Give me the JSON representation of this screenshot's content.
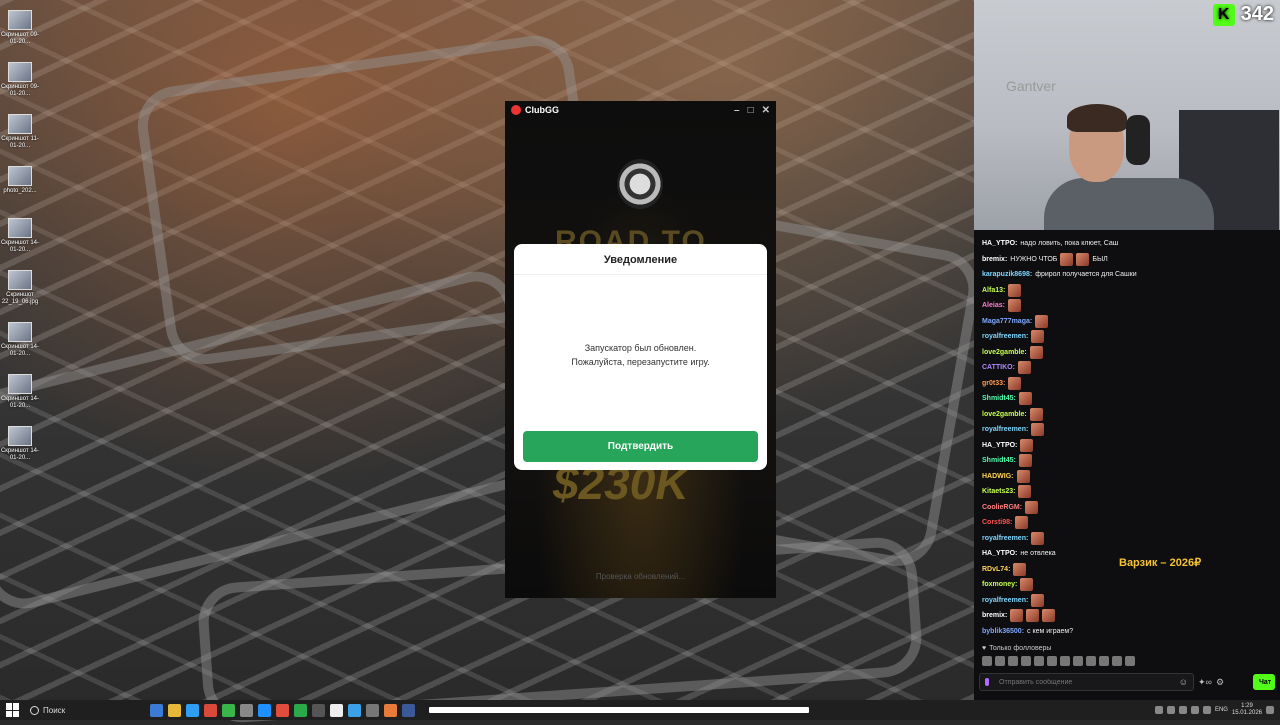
{
  "desktop": {
    "icons": [
      {
        "label": "Скриншот 09-01-20..."
      },
      {
        "label": "Скриншот 09-01-20..."
      },
      {
        "label": "Скриншот 11-01-20..."
      },
      {
        "label": "photo_202..."
      },
      {
        "label": "Скриншот 14-01-20..."
      },
      {
        "label": "Скриншот 22_19_06.jpg"
      },
      {
        "label": "Скриншот 14-01-20..."
      },
      {
        "label": "Скриншот 14-01-20..."
      },
      {
        "label": "Скриншот 14-01-20..."
      }
    ]
  },
  "launcher": {
    "title": "ClubGG",
    "road_to": "ROAD TO",
    "prize": "$230K",
    "status": "Проверка обновлений..."
  },
  "dialog": {
    "title": "Уведомление",
    "message_line1": "Запускатор был обновлен.",
    "message_line2": "Пожалуйста, перезапустите игру.",
    "confirm_label": "Подтвердить"
  },
  "stream": {
    "viewer_count": "342",
    "wall_text": "Gantver",
    "overlay_text": "Варзик – 2026₽"
  },
  "chat": {
    "messages": [
      {
        "user": "HA_YTPO:",
        "text": "надо ловить, пока клюет, Саш",
        "color": "#ffffff",
        "emotes": 0
      },
      {
        "user": "bremix:",
        "text": "НУЖНО ЧТОБ",
        "text2": "БЫЛ",
        "color": "#ffffff",
        "emotes": 2
      },
      {
        "user": "karapuzik8698:",
        "text": "фрирол получается для Сашки",
        "color": "#7fd6ff",
        "emotes": 0
      },
      {
        "user": "Alfa13:",
        "text": "",
        "color": "#c6ff52",
        "emotes": 1
      },
      {
        "user": "Aleias:",
        "text": "",
        "color": "#ff7fd0",
        "emotes": 1
      },
      {
        "user": "Maga777maga:",
        "text": "",
        "color": "#7fa8ff",
        "emotes": 1
      },
      {
        "user": "royalfreemen:",
        "text": "",
        "color": "#7fd6ff",
        "emotes": 1
      },
      {
        "user": "love2gamble:",
        "text": "",
        "color": "#c6ff52",
        "emotes": 1
      },
      {
        "user": "CATTIKO:",
        "text": "",
        "color": "#b088ff",
        "emotes": 1
      },
      {
        "user": "gr0t33:",
        "text": "",
        "color": "#ff9a52",
        "emotes": 1
      },
      {
        "user": "Shmidt45:",
        "text": "",
        "color": "#52ffb0",
        "emotes": 1
      },
      {
        "user": "love2gamble:",
        "text": "",
        "color": "#c6ff52",
        "emotes": 1
      },
      {
        "user": "royalfreemen:",
        "text": "",
        "color": "#7fd6ff",
        "emotes": 1
      },
      {
        "user": "HA_YTPO:",
        "text": "",
        "color": "#ffffff",
        "emotes": 1
      },
      {
        "user": "Shmidt45:",
        "text": "",
        "color": "#52ffb0",
        "emotes": 1
      },
      {
        "user": "HADWIG:",
        "text": "",
        "color": "#ffd452",
        "emotes": 1
      },
      {
        "user": "Kitaets23:",
        "text": "",
        "color": "#c6ff52",
        "emotes": 1
      },
      {
        "user": "CoolieRGM:",
        "text": "",
        "color": "#ff7f7f",
        "emotes": 1
      },
      {
        "user": "Corsti98:",
        "text": "",
        "color": "#ff5252",
        "emotes": 1
      },
      {
        "user": "royalfreemen:",
        "text": "",
        "color": "#7fd6ff",
        "emotes": 1
      },
      {
        "user": "HA_YTPO:",
        "text": "не отвлека",
        "color": "#ffffff",
        "emotes": 0
      },
      {
        "user": "RDvL74:",
        "text": "",
        "color": "#ffd452",
        "emotes": 1
      },
      {
        "user": "foxmoney:",
        "text": "",
        "color": "#c6ff52",
        "emotes": 1
      },
      {
        "user": "royalfreemen:",
        "text": "",
        "color": "#7fd6ff",
        "emotes": 1
      },
      {
        "user": "bremix:",
        "text": "",
        "color": "#ffffff",
        "emotes": 3
      },
      {
        "user": "byblik36500:",
        "text": "с кем играем?",
        "color": "#7fa8ff",
        "emotes": 0
      }
    ],
    "followers_only": "Только фолловеры",
    "input_placeholder": "Отправить сообщение",
    "send_label": "Чат"
  },
  "taskbar": {
    "search_label": "Поиск",
    "lang": "ENG",
    "time": "1:29",
    "date": "15.01.2026"
  }
}
